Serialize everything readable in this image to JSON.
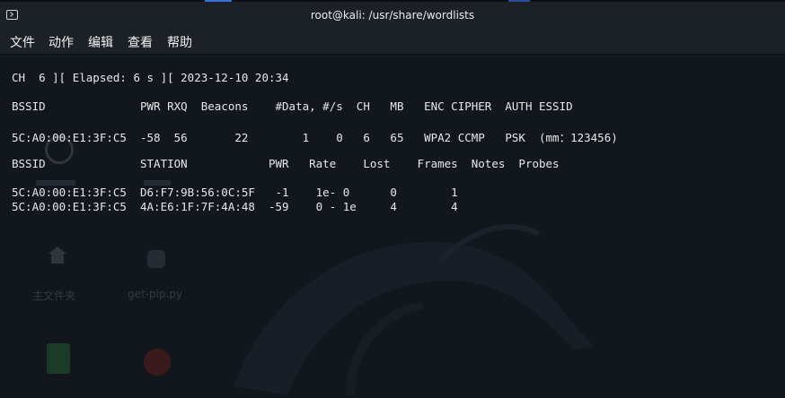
{
  "window": {
    "title": "root@kali: /usr/share/wordlists",
    "title_icon": "terminal-icon"
  },
  "menu": {
    "items": [
      {
        "label": "文件"
      },
      {
        "label": "动作"
      },
      {
        "label": "编辑"
      },
      {
        "label": "查看"
      },
      {
        "label": "帮助"
      }
    ]
  },
  "terminal": {
    "status_line": "CH  6 ][ Elapsed: 6 s ][ 2023-12-10 20:34",
    "ap_header": "BSSID              PWR RXQ  Beacons    #Data, #/s  CH   MB   ENC CIPHER  AUTH ESSID",
    "ap_rows": [
      "5C:A0:00:E1:3F:C5  -58  56       22        1    0   6   65   WPA2 CCMP   PSK  (mm：123456)"
    ],
    "station_header": "BSSID              STATION            PWR   Rate    Lost    Frames  Notes  Probes",
    "station_rows": [
      "5C:A0:00:E1:3F:C5  D6:F7:9B:56:0C:5F   -1    1e- 0      0        1",
      "5C:A0:00:E1:3F:C5  4A:E6:1F:7F:4A:48  -59    0 - 1e     4        4"
    ]
  },
  "desktop": {
    "icon_labels": [
      "主文件夹",
      "get-pip.py"
    ]
  },
  "colors": {
    "background": "#12161d",
    "titlebar": "#1c2027",
    "text": "#e8e8e8"
  }
}
